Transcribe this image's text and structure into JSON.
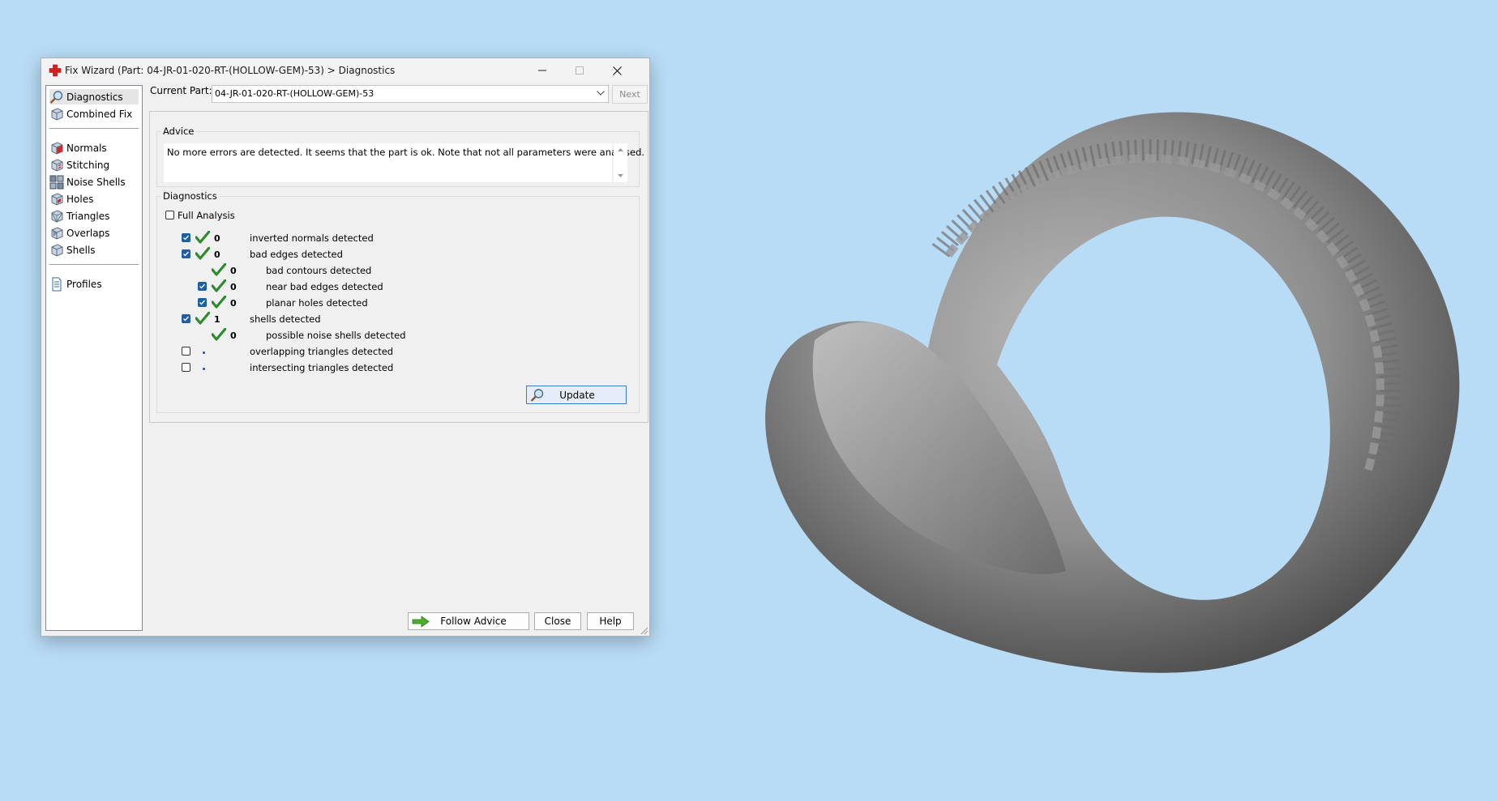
{
  "window": {
    "title": "Fix Wizard (Part: 04-JR-01-020-RT-(HOLLOW-GEM)-53) > Diagnostics"
  },
  "sidebar": {
    "items": [
      {
        "label": "Diagnostics",
        "icon": "magnifier-icon"
      },
      {
        "label": "Combined Fix",
        "icon": "cube-icon"
      },
      {
        "label": "Normals",
        "icon": "normals-cube-icon"
      },
      {
        "label": "Stitching",
        "icon": "stitching-cube-icon"
      },
      {
        "label": "Noise Shells",
        "icon": "noise-shells-icon"
      },
      {
        "label": "Holes",
        "icon": "holes-cube-icon"
      },
      {
        "label": "Triangles",
        "icon": "triangles-cube-icon"
      },
      {
        "label": "Overlaps",
        "icon": "overlaps-cube-icon"
      },
      {
        "label": "Shells",
        "icon": "shells-cube-icon"
      },
      {
        "label": "Profiles",
        "icon": "document-icon"
      }
    ]
  },
  "current_part": {
    "label": "Current Part:",
    "value": "04-JR-01-020-RT-(HOLLOW-GEM)-53",
    "next_label": "Next"
  },
  "advice": {
    "caption": "Advice",
    "text": "No more errors are detected. It seems that the part is ok. Note that not all parameters were analysed."
  },
  "diagnostics": {
    "caption": "Diagnostics",
    "full_analysis_label": "Full Analysis",
    "full_analysis_checked": false,
    "rows": [
      {
        "count": "0",
        "label": "inverted normals detected",
        "checked": true,
        "status": "ok"
      },
      {
        "count": "0",
        "label": "bad edges detected",
        "checked": true,
        "status": "ok"
      },
      {
        "count": "0",
        "label": "bad contours detected",
        "checked": null,
        "status": "ok"
      },
      {
        "count": "0",
        "label": "near bad edges detected",
        "checked": true,
        "status": "ok"
      },
      {
        "count": "0",
        "label": "planar holes detected",
        "checked": true,
        "status": "ok"
      },
      {
        "count": "1",
        "label": "shells detected",
        "checked": true,
        "status": "ok"
      },
      {
        "count": "0",
        "label": "possible noise shells detected",
        "checked": null,
        "status": "ok"
      },
      {
        "count": "",
        "label": "overlapping triangles detected",
        "checked": false,
        "status": "pending"
      },
      {
        "count": "",
        "label": "intersecting triangles detected",
        "checked": false,
        "status": "pending"
      }
    ],
    "update_label": "Update"
  },
  "footer": {
    "follow_advice_label": "Follow Advice",
    "close_label": "Close",
    "help_label": "Help"
  },
  "colors": {
    "background": "#b9dcf6",
    "check_green": "#2f8a2f",
    "checkbox_blue": "#1f5f9e"
  }
}
